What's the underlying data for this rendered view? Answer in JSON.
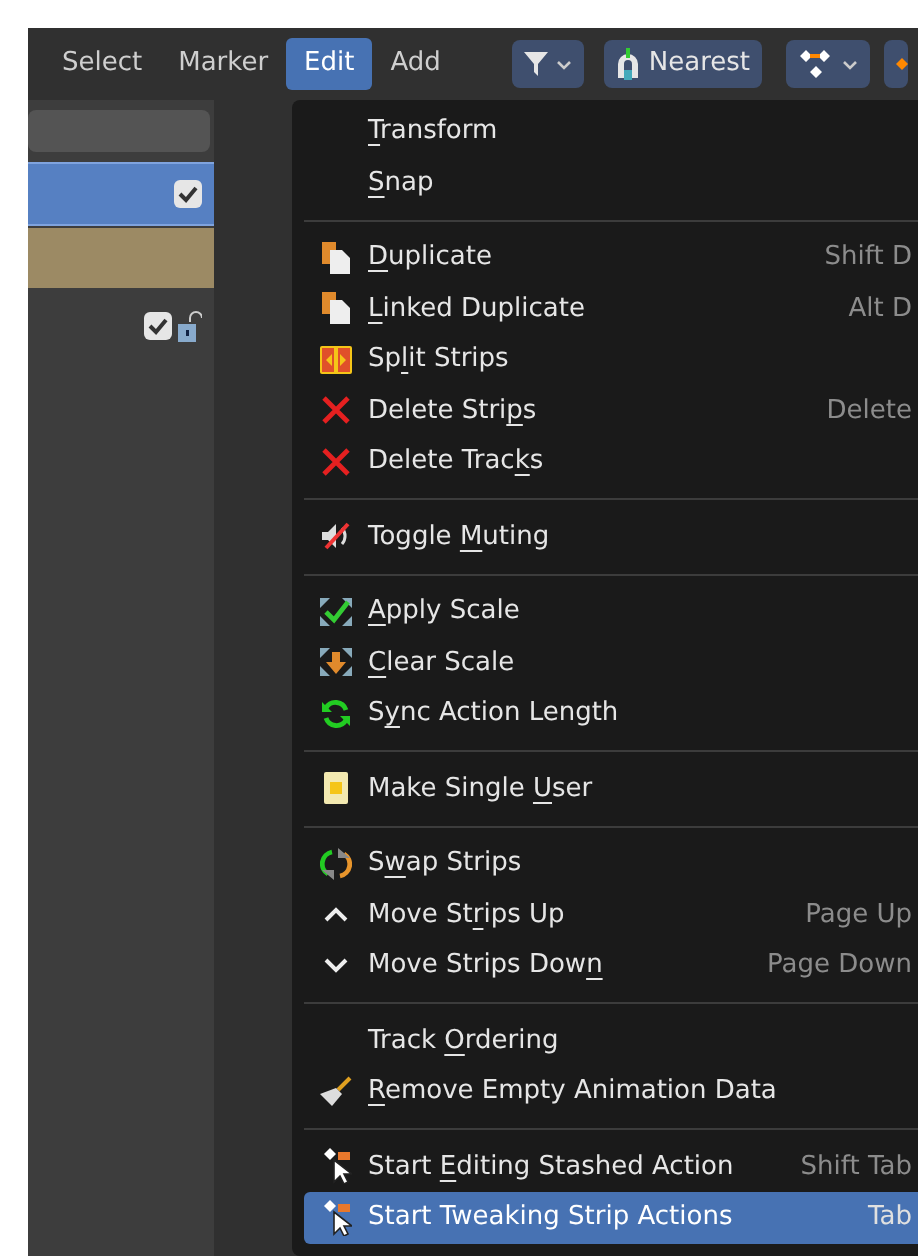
{
  "header": {
    "menus": [
      {
        "label": "Select",
        "selected": false
      },
      {
        "label": "Marker",
        "selected": false
      },
      {
        "label": "Edit",
        "selected": true
      },
      {
        "label": "Add",
        "selected": false
      }
    ],
    "snap_mode": "Nearest"
  },
  "channels": [
    {
      "kind": "action",
      "selected": true,
      "checked": true
    },
    {
      "kind": "object",
      "selected": false
    },
    {
      "kind": "track",
      "selected": false,
      "checked": true,
      "locked": false
    }
  ],
  "menu": {
    "items": [
      {
        "kind": "submenu",
        "label": "Transform"
      },
      {
        "kind": "submenu",
        "label": "Snap"
      },
      {
        "kind": "separator"
      },
      {
        "kind": "item",
        "label": "Duplicate",
        "shortcut": "Shift D"
      },
      {
        "kind": "item",
        "label": "Linked Duplicate",
        "shortcut": "Alt D"
      },
      {
        "kind": "item",
        "label": "Split Strips"
      },
      {
        "kind": "item",
        "label": "Delete Strips",
        "shortcut": "Delete"
      },
      {
        "kind": "item",
        "label": "Delete Tracks"
      },
      {
        "kind": "separator"
      },
      {
        "kind": "item",
        "label": "Toggle Muting"
      },
      {
        "kind": "separator"
      },
      {
        "kind": "item",
        "label": "Apply Scale"
      },
      {
        "kind": "item",
        "label": "Clear Scale"
      },
      {
        "kind": "item",
        "label": "Sync Action Length"
      },
      {
        "kind": "separator"
      },
      {
        "kind": "item",
        "label": "Make Single User"
      },
      {
        "kind": "separator"
      },
      {
        "kind": "item",
        "label": "Swap Strips"
      },
      {
        "kind": "item",
        "label": "Move Strips Up",
        "shortcut": "Page Up"
      },
      {
        "kind": "item",
        "label": "Move Strips Down",
        "shortcut": "Page Down"
      },
      {
        "kind": "separator"
      },
      {
        "kind": "submenu",
        "label": "Track Ordering"
      },
      {
        "kind": "item",
        "label": "Remove Empty Animation Data"
      },
      {
        "kind": "separator"
      },
      {
        "kind": "item",
        "label": "Start Editing Stashed Action",
        "shortcut": "Shift Tab",
        "selected": false
      },
      {
        "kind": "item",
        "label": "Start Tweaking Strip Actions",
        "shortcut": "Tab",
        "selected": true
      }
    ]
  }
}
